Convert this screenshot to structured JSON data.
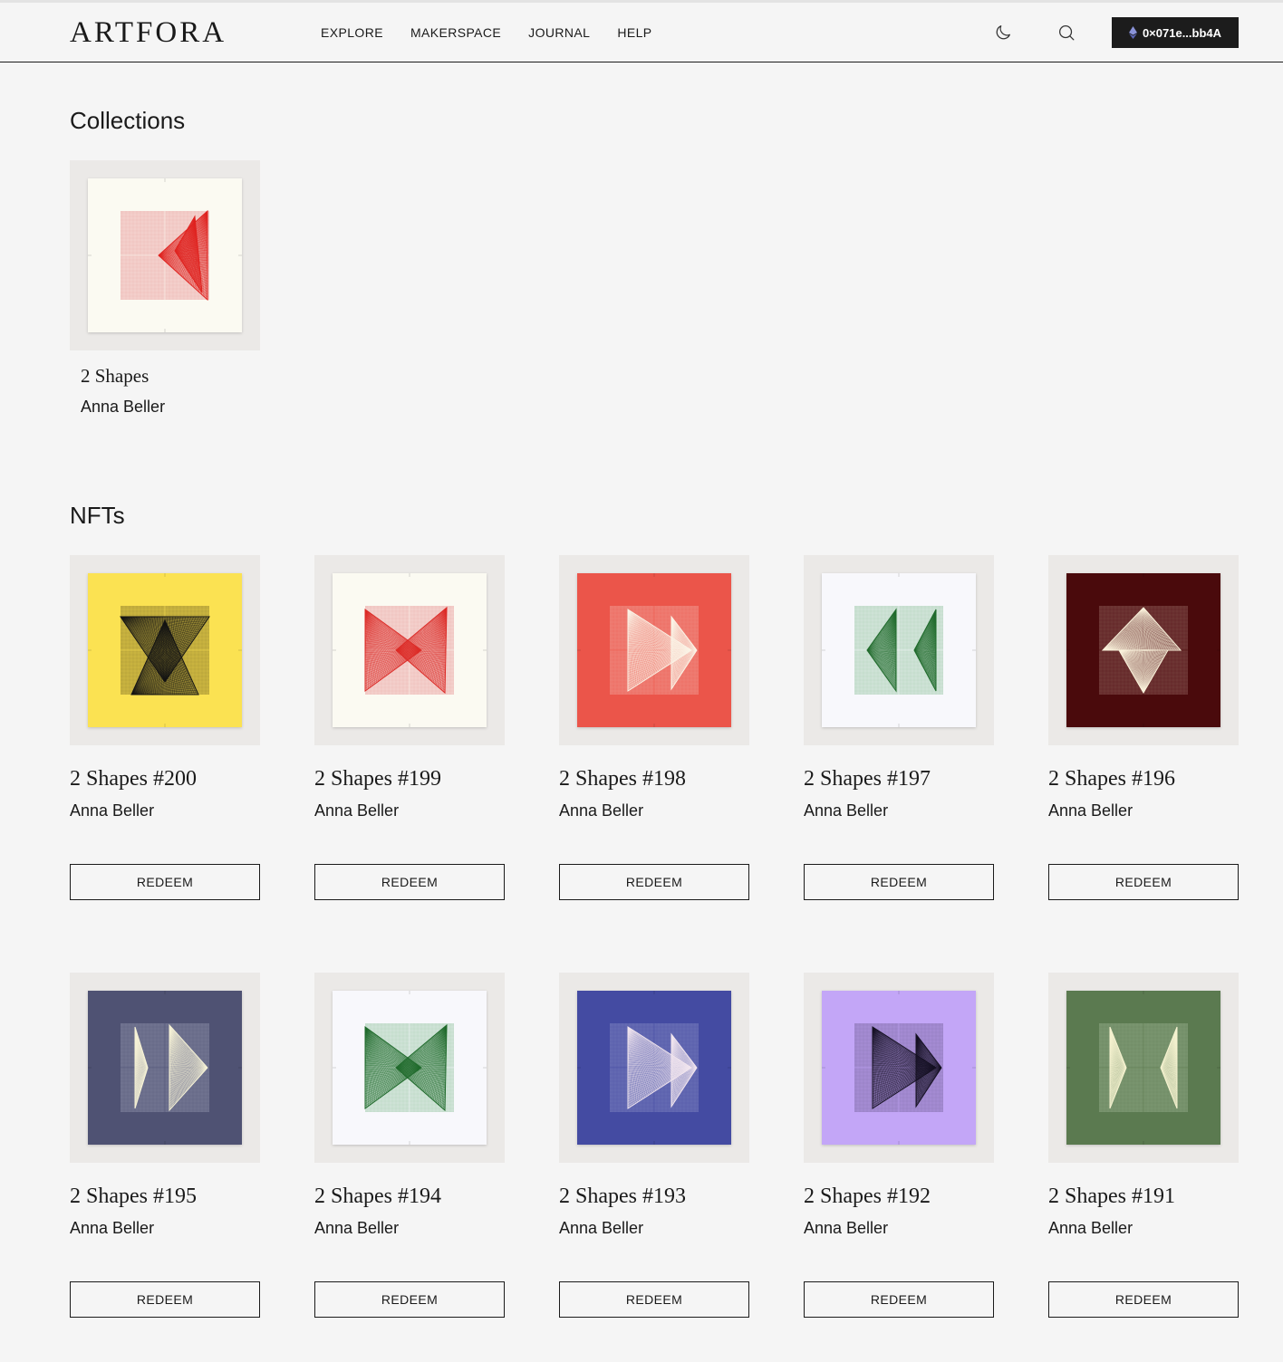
{
  "header": {
    "logo": "ARTFORA",
    "nav": [
      "EXPLORE",
      "MAKERSPACE",
      "JOURNAL",
      "HELP"
    ],
    "icons": [
      "moon-icon",
      "search-icon"
    ],
    "wallet_label": "0×071e...bb4A"
  },
  "collections_section": {
    "title": "Collections",
    "items": [
      {
        "title": "2 Shapes",
        "artist": "Anna Beller",
        "bg": "#fbfaf2",
        "grid": "#ea9c9c",
        "ink": "#e0231f",
        "shape": "left-small"
      }
    ]
  },
  "nfts_section": {
    "title": "NFTs",
    "button_label": "REDEEM",
    "items": [
      {
        "title": "2 Shapes #200",
        "artist": "Anna Beller",
        "bg": "#fbe252",
        "grid": "#8d7c2a",
        "ink": "#141414",
        "shape": "hourglass"
      },
      {
        "title": "2 Shapes #199",
        "artist": "Anna Beller",
        "bg": "#fbfaf2",
        "grid": "#ea9c9c",
        "ink": "#dc2a26",
        "shape": "bowtie"
      },
      {
        "title": "2 Shapes #198",
        "artist": "Anna Beller",
        "bg": "#eb554a",
        "grid": "#f19a92",
        "ink": "#fbf4e7",
        "shape": "arrow-right"
      },
      {
        "title": "2 Shapes #197",
        "artist": "Anna Beller",
        "bg": "#f8f8fc",
        "grid": "#9cc8a8",
        "ink": "#1f6a2b",
        "shape": "two-left"
      },
      {
        "title": "2 Shapes #196",
        "artist": "Anna Beller",
        "bg": "#4a0a0c",
        "grid": "#8a5a54",
        "ink": "#fbf3dc",
        "shape": "diamond"
      },
      {
        "title": "2 Shapes #195",
        "artist": "Anna Beller",
        "bg": "#4f5273",
        "grid": "#8a8ca6",
        "ink": "#f7f3d6",
        "shape": "two-right"
      },
      {
        "title": "2 Shapes #194",
        "artist": "Anna Beller",
        "bg": "#f8f8fc",
        "grid": "#9cc8a8",
        "ink": "#1f6a2b",
        "shape": "bowtie"
      },
      {
        "title": "2 Shapes #193",
        "artist": "Anna Beller",
        "bg": "#444ba2",
        "grid": "#7e83c0",
        "ink": "#f2e6ee",
        "shape": "arrow-right"
      },
      {
        "title": "2 Shapes #192",
        "artist": "Anna Beller",
        "bg": "#c3a6f7",
        "grid": "#7e6aa6",
        "ink": "#151122",
        "shape": "arrow-right"
      },
      {
        "title": "2 Shapes #191",
        "artist": "Anna Beller",
        "bg": "#5b7a50",
        "grid": "#91a987",
        "ink": "#f6f3d1",
        "shape": "two-apart"
      }
    ]
  }
}
